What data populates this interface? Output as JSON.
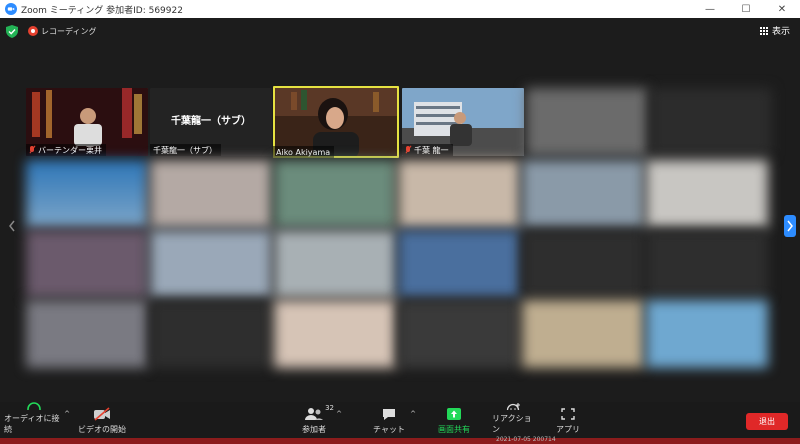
{
  "window": {
    "title": "Zoom ミーティング 参加者ID: 569922",
    "minimize": "—",
    "maximize": "☐",
    "close": "✕"
  },
  "topbar": {
    "recording_label": "レコーディング",
    "view_label": "表示"
  },
  "tiles": [
    {
      "name": "バーテンダー栗井",
      "label_visible": true
    },
    {
      "name": "千葉龍一（サブ）",
      "center": "千葉龍一（サブ）",
      "label_visible": true
    },
    {
      "name": "Aiko Akiyama",
      "label_visible": true
    },
    {
      "name": "千葉 龍一",
      "label_visible": true
    }
  ],
  "toolbar": {
    "audio": "オーディオに接続",
    "video": "ビデオの開始",
    "participants": "参加者",
    "participant_count": "32",
    "chat": "チャット",
    "share": "画面共有",
    "reactions": "リアクション",
    "apps": "アプリ",
    "leave": "退出",
    "caret": "^"
  },
  "footer_date": "2021-07-05 200714",
  "colors": {
    "accent": "#2d8cff",
    "share_green": "#23d959",
    "leave_red": "#e02828",
    "speaker_border": "#e6e241"
  }
}
